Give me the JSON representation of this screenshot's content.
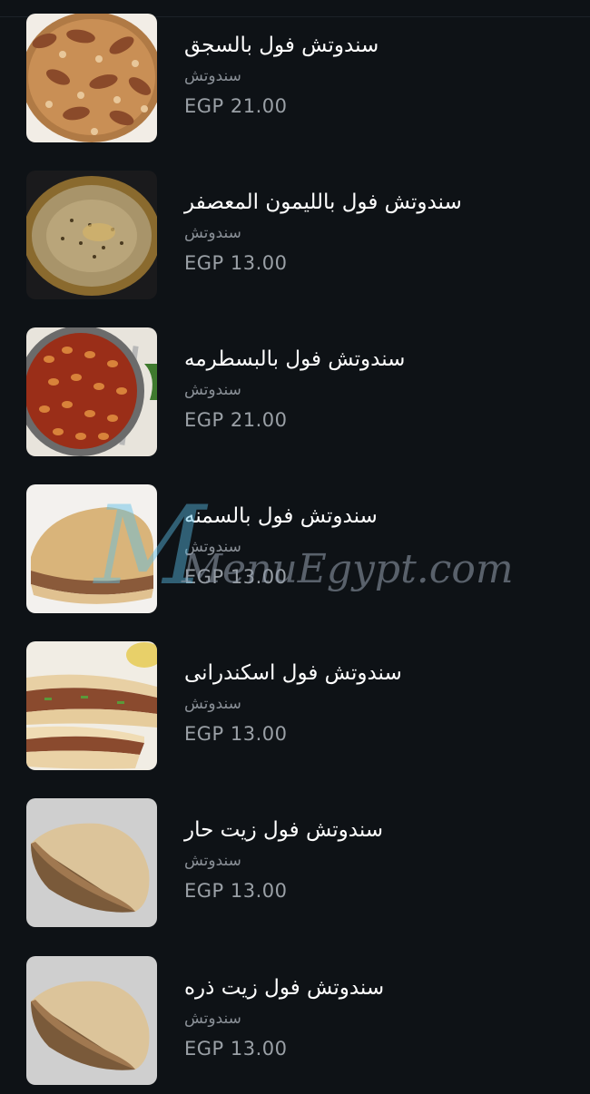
{
  "menu": {
    "items": [
      {
        "name": "سندوتش فول بالسجق",
        "category": "سندوتش",
        "price": "EGP 21.00",
        "image": "fava-beans-sausage-photo"
      },
      {
        "name": "سندوتش فول بالليمون المعصفر",
        "category": "سندوتش",
        "price": "EGP 13.00",
        "image": "fava-beans-lemon-soup-photo"
      },
      {
        "name": "سندوتش فول بالبسطرمه",
        "category": "سندوتش",
        "price": "EGP 21.00",
        "image": "fava-beans-pastrami-photo"
      },
      {
        "name": "سندوتش فول بالسمنه",
        "category": "سندوتش",
        "price": "EGP 13.00",
        "image": "fava-sandwich-ghee-photo"
      },
      {
        "name": "سندوتش فول اسكندرانى",
        "category": "سندوتش",
        "price": "EGP 13.00",
        "image": "fava-sandwich-alexandrian-photo"
      },
      {
        "name": "سندوتش فول زيت حار",
        "category": "سندوتش",
        "price": "EGP 13.00",
        "image": "fava-sandwich-hot-oil-photo"
      },
      {
        "name": "سندوتش فول زيت ذره",
        "category": "سندوتش",
        "price": "EGP 13.00",
        "image": "fava-sandwich-corn-oil-photo"
      }
    ]
  },
  "watermark": {
    "text": "MenuEgypt.com"
  },
  "colors": {
    "background": "#0e1216",
    "name_text": "#ffffff",
    "category_text": "#8a9097",
    "price_text": "#9aa0a6"
  }
}
